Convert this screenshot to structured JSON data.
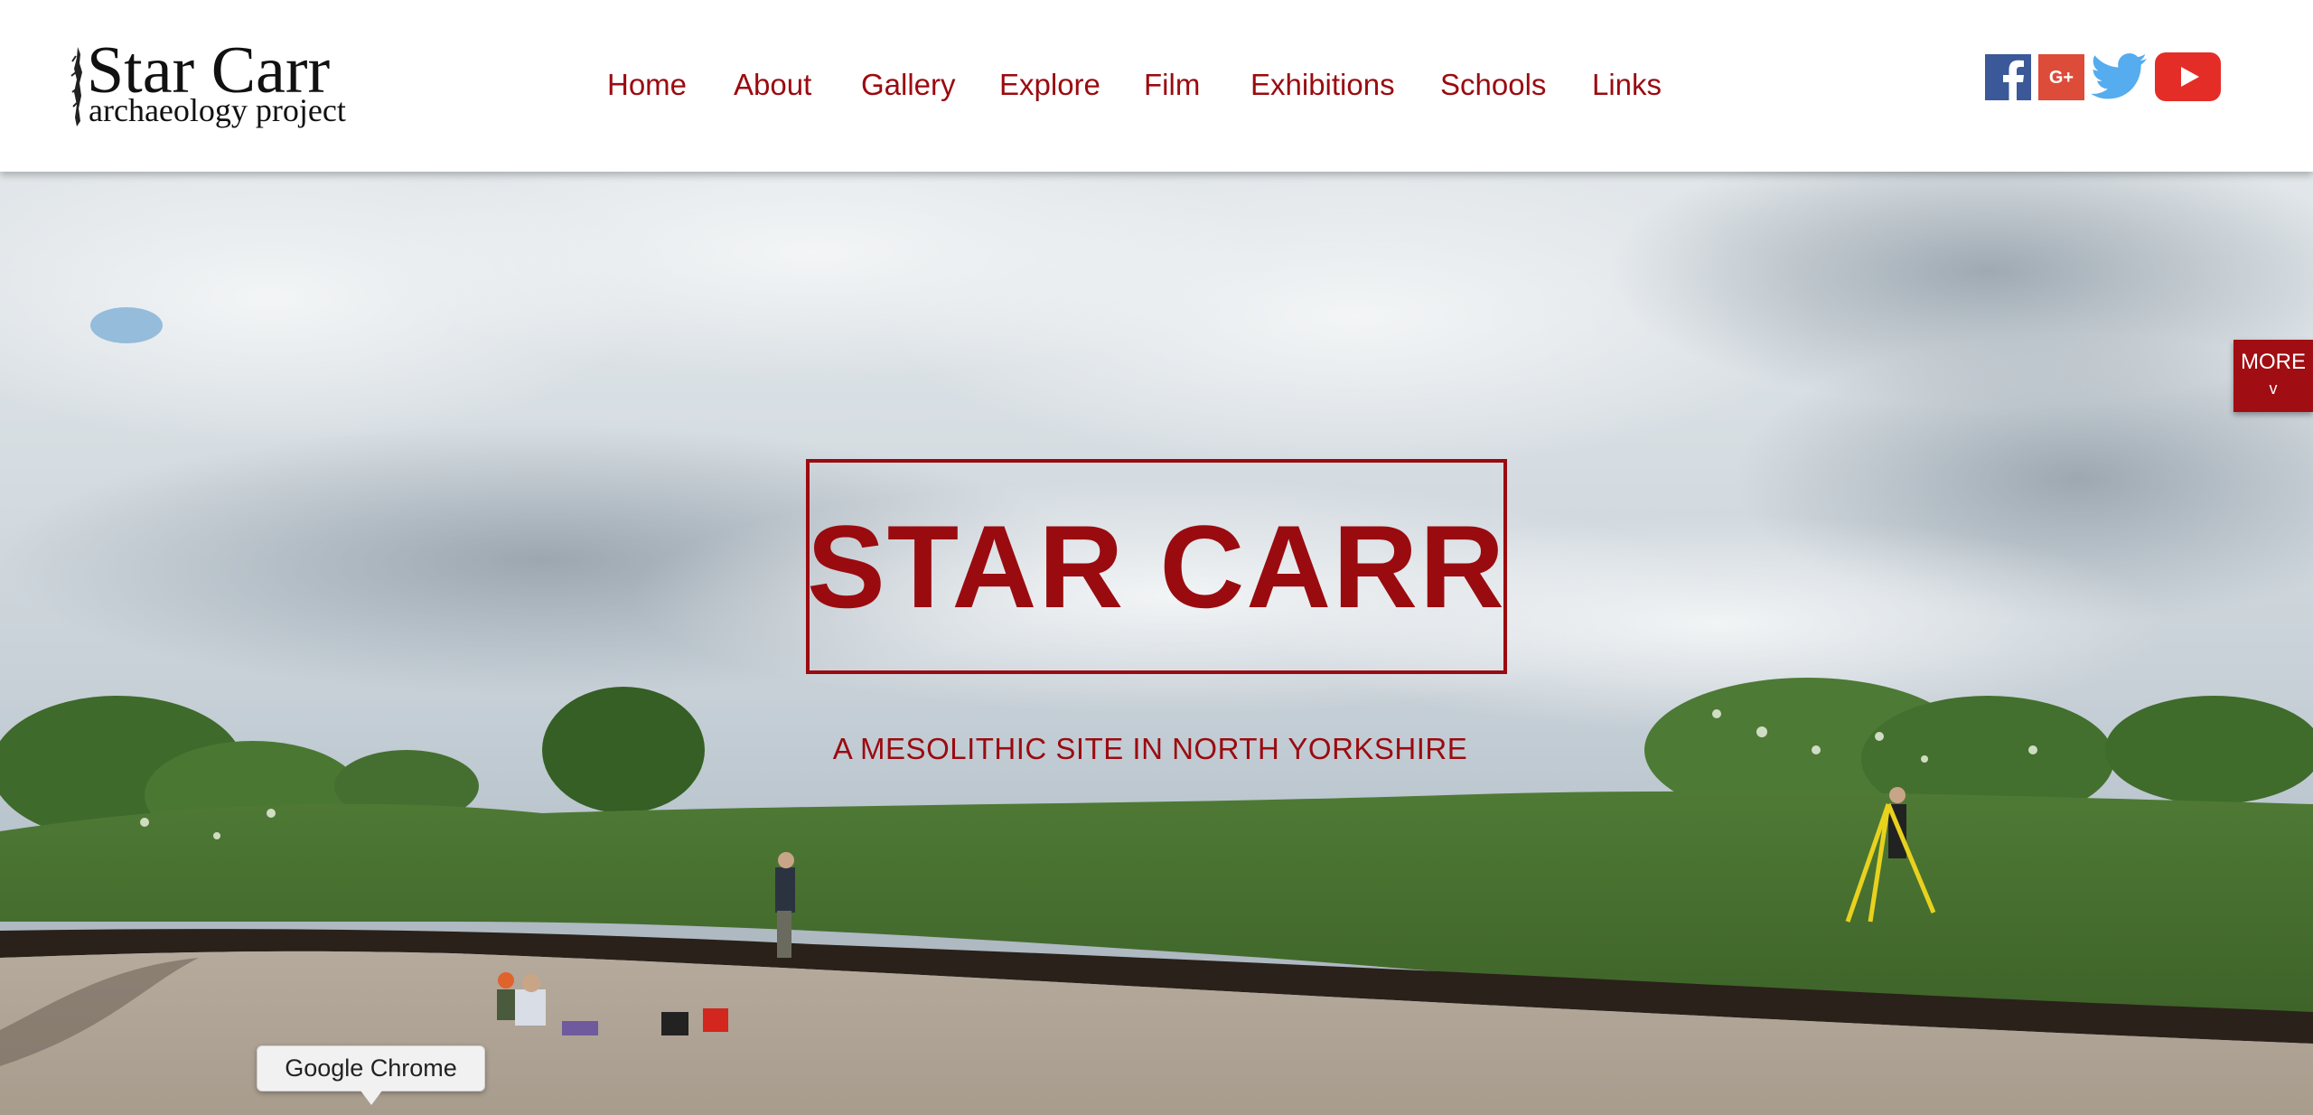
{
  "logo": {
    "title": "Star Carr",
    "subtitle": "archaeology project"
  },
  "nav": {
    "items": [
      {
        "label": "Home"
      },
      {
        "label": "About"
      },
      {
        "label": "Gallery"
      },
      {
        "label": "Explore"
      },
      {
        "label": "Film"
      },
      {
        "label": "Exhibitions"
      },
      {
        "label": "Schools"
      },
      {
        "label": "Links"
      }
    ]
  },
  "social": {
    "icons": [
      "facebook-icon",
      "google-plus-icon",
      "twitter-icon",
      "youtube-icon"
    ],
    "gplus_text": "G+"
  },
  "hero": {
    "title": "STAR CARR",
    "subtitle": "A MESOLITHIC SITE IN NORTH YORKSHIRE"
  },
  "more_tab": {
    "label": "MORE",
    "chevron": "v"
  },
  "tooltip": {
    "text": "Google Chrome"
  },
  "colors": {
    "accent": "#9a0b10",
    "header_bg": "#ffffff",
    "facebook": "#3b5998",
    "google_plus": "#dd4b39",
    "twitter": "#55acee",
    "youtube": "#e52d27"
  }
}
